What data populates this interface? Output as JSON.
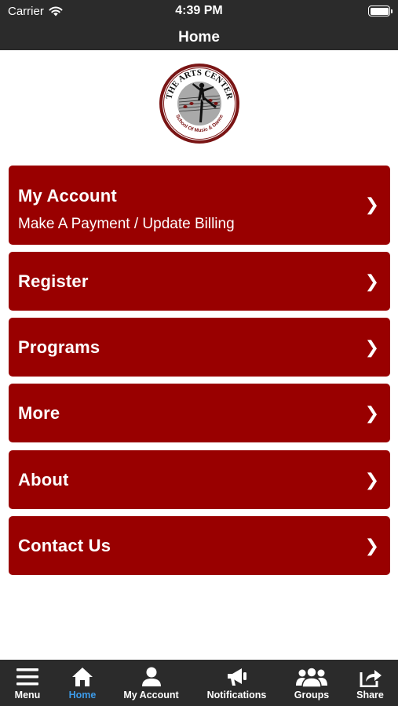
{
  "status_bar": {
    "carrier": "Carrier",
    "time": "4:39 PM"
  },
  "nav": {
    "title": "Home"
  },
  "logo": {
    "text_top": "THE ARTS CENTER",
    "text_bottom": "School Of Music & Dance"
  },
  "menu": [
    {
      "label": "My Account",
      "sublabel": "Make A Payment / Update Billing",
      "chevron": "❯"
    },
    {
      "label": "Register",
      "chevron": "❯"
    },
    {
      "label": "Programs",
      "chevron": "❯"
    },
    {
      "label": "More",
      "chevron": "❯"
    },
    {
      "label": "About",
      "chevron": "❯"
    },
    {
      "label": "Contact Us",
      "chevron": "❯"
    }
  ],
  "tabs": [
    {
      "label": "Menu",
      "icon": "hamburger-icon"
    },
    {
      "label": "Home",
      "icon": "home-icon",
      "active": true
    },
    {
      "label": "My Account",
      "icon": "person-icon"
    },
    {
      "label": "Notifications",
      "icon": "megaphone-icon"
    },
    {
      "label": "Groups",
      "icon": "group-icon"
    },
    {
      "label": "Share",
      "icon": "share-icon"
    }
  ],
  "colors": {
    "bar": "#2b2b2b",
    "button": "#990000",
    "active_tab": "#3d9be9"
  }
}
